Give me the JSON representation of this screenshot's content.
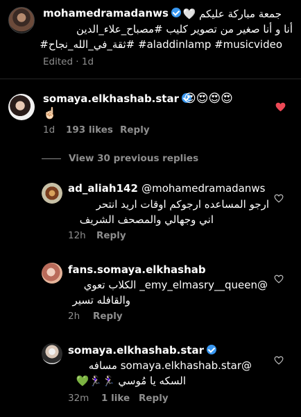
{
  "caption": {
    "username": "mohamedramadanws",
    "line1": "جمعة مباركة عليكم 🤍",
    "line2": "أنا و أنا صغير من تصوير كليب #مصباح_علاء_الدين",
    "line3": "aladdinlamp #musicvideo# #ثقة_في_الله_نجاح#",
    "meta": "Edited · 1d"
  },
  "top_comment": {
    "username": "somaya.elkhashab.star",
    "text": "😍😍😍😍",
    "text2": "☝🏻",
    "time": "1d",
    "likes": "193 likes",
    "reply": "Reply"
  },
  "view_replies": "View 30 previous replies",
  "replies": [
    {
      "username": "ad_aliah142",
      "mention": "@mohamedramadanws",
      "line1": "ارجو المساعده ارجوكم اوقات اريد انتحر",
      "line2": "اني وجهالي والمصحف الشريف",
      "time": "12h",
      "reply": "Reply"
    },
    {
      "username": "fans.somaya.elkhashab",
      "line1": "@emy_elmasry__queen_ الكلاب تعوي",
      "line2": "والقافله تسير",
      "time": "2h",
      "reply": "Reply"
    },
    {
      "username": "somaya.elkhashab.star",
      "line1": "@somaya.elkhashab.star مسافه",
      "line2": "السكه يا مُوسي 🏃🏻‍♀️🏃🏻‍♀️💚",
      "time": "32m",
      "likes": "1 like",
      "reply": "Reply"
    }
  ],
  "colors": {
    "background": "#000000",
    "text": "#ffffff",
    "muted": "#8e8e8e",
    "verified": "#3897f0",
    "like_red": "#ed4956"
  }
}
